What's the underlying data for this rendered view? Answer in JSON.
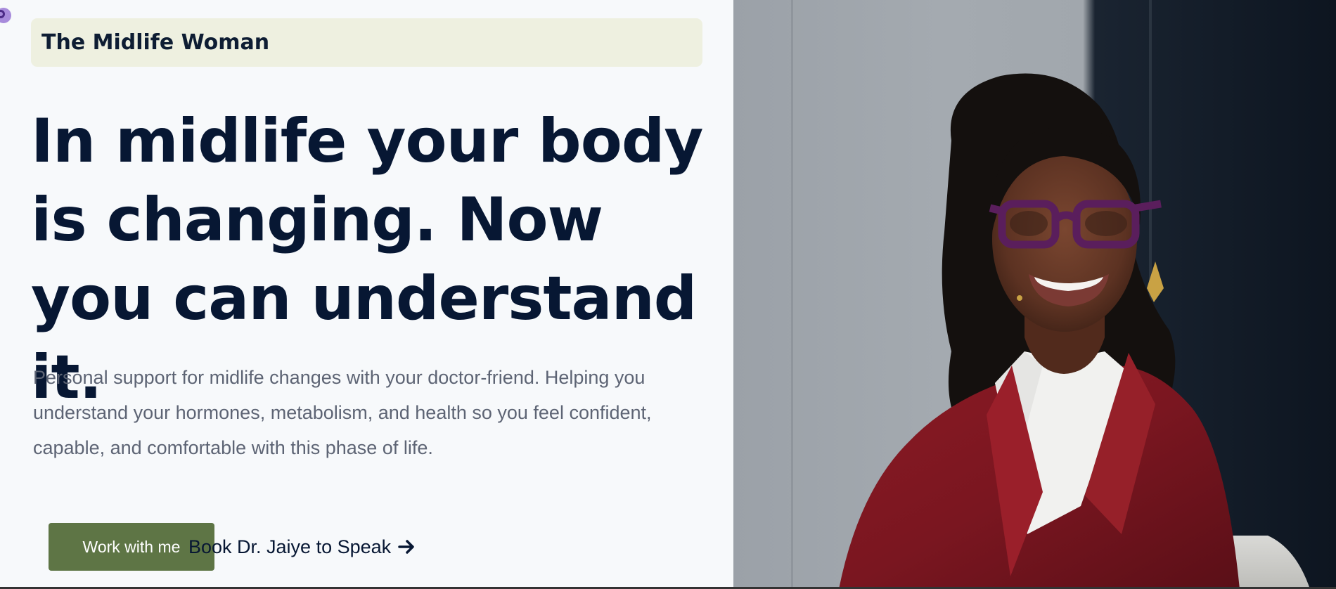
{
  "brand": {
    "name": "The Midlife Woman"
  },
  "hero": {
    "headline": "In midlife your body is changing. Now you can understand it.",
    "subtext": "Personal support for midlife changes with your doctor-friend. Helping you understand your hormones, metabolism, and health so you feel confident, capable, and comfortable with this phase of life.",
    "primary_button_label": "Work with me",
    "secondary_link_label": "Book Dr. Jaiye to Speak",
    "arrow_icon": "arrow-right-icon"
  },
  "portrait": {
    "icon": "portrait-photo"
  },
  "colors": {
    "background": "#f7f9fb",
    "brand_bar": "#eef0e0",
    "headline": "#071733",
    "body_text": "#5d6474",
    "button": "#5e7545",
    "button_text": "#ffffff"
  }
}
